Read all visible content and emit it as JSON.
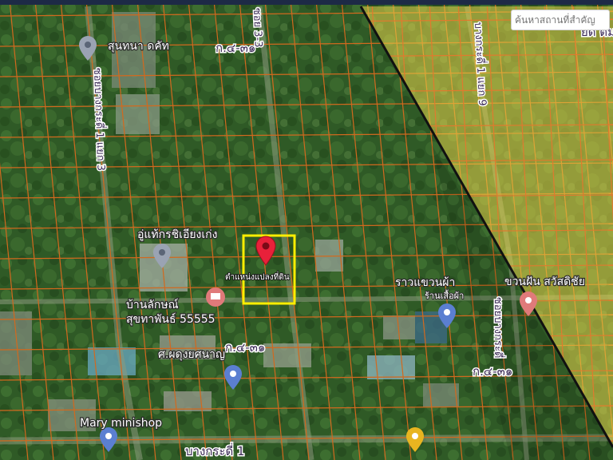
{
  "search": {
    "placeholder": "ค้นหาสถานที่สำคัญ"
  },
  "parcel": {
    "label": "ตำแหน่งแปลงที่ดิน"
  },
  "roads": {
    "ko31_top": "ก.๔-๓๑",
    "ko31_mid": "ก.๔-๓๑",
    "ko31_right": "ก.๔-๓๑",
    "bangkradi1": "บางกระดี่ 1",
    "soi_left": "ซอยบางกระดี่ 1 แยก 3",
    "soi_right_v": "ซอยบางกระดี่ 1 แยก 9",
    "soi_top_v": "ซอย 3-3",
    "soi_right_top": "บางกระดี่ 1 แยก 9",
    "soi_bottom_v": "ซอยบางกระดี่"
  },
  "places": {
    "sumthana": "สุนทนา ดคัท",
    "uthai": "อู่แท้กรชิเอียงเก่ง",
    "ban_lak": "บ้านลักษณ์",
    "suk_thaphan": "สุขทาพันธ์ 55555",
    "sor_phadung": "ศ.ผดุงยศนาญ",
    "mary": "Mary minishop",
    "rao_khaeng": "ราวแขวนผ้า",
    "raan_sue": "ร้านเสื้อผ้า",
    "khuan_fan": "ขวนฝัน สวัสดิชัย",
    "top_right": "ยด ตม"
  },
  "colors": {
    "overlay": "#e8d44a",
    "parcel_lines": "#d2691e",
    "parcel_highlight": "#ffee00",
    "pin": "#e8213a"
  },
  "icons": {
    "location_pin": "map-pin-icon",
    "poi_blue": "poi-marker-icon",
    "poi_orange": "poi-marker-icon"
  }
}
